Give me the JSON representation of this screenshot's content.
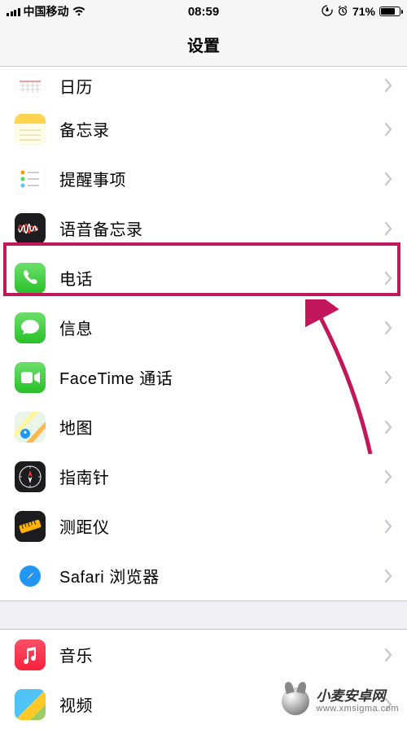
{
  "status": {
    "carrier": "中国移动",
    "time": "08:59",
    "battery_pct": "71%"
  },
  "nav": {
    "title": "设置"
  },
  "rows": {
    "calendar": "日历",
    "notes": "备忘录",
    "reminders": "提醒事项",
    "voicememo": "语音备忘录",
    "phone": "电话",
    "messages": "信息",
    "facetime": "FaceTime 通话",
    "maps": "地图",
    "compass": "指南针",
    "measure": "测距仪",
    "safari": "Safari 浏览器",
    "music": "音乐",
    "video": "视频"
  },
  "watermark": {
    "main": "小麦安卓网",
    "sub": "www.xmsigma.com"
  }
}
